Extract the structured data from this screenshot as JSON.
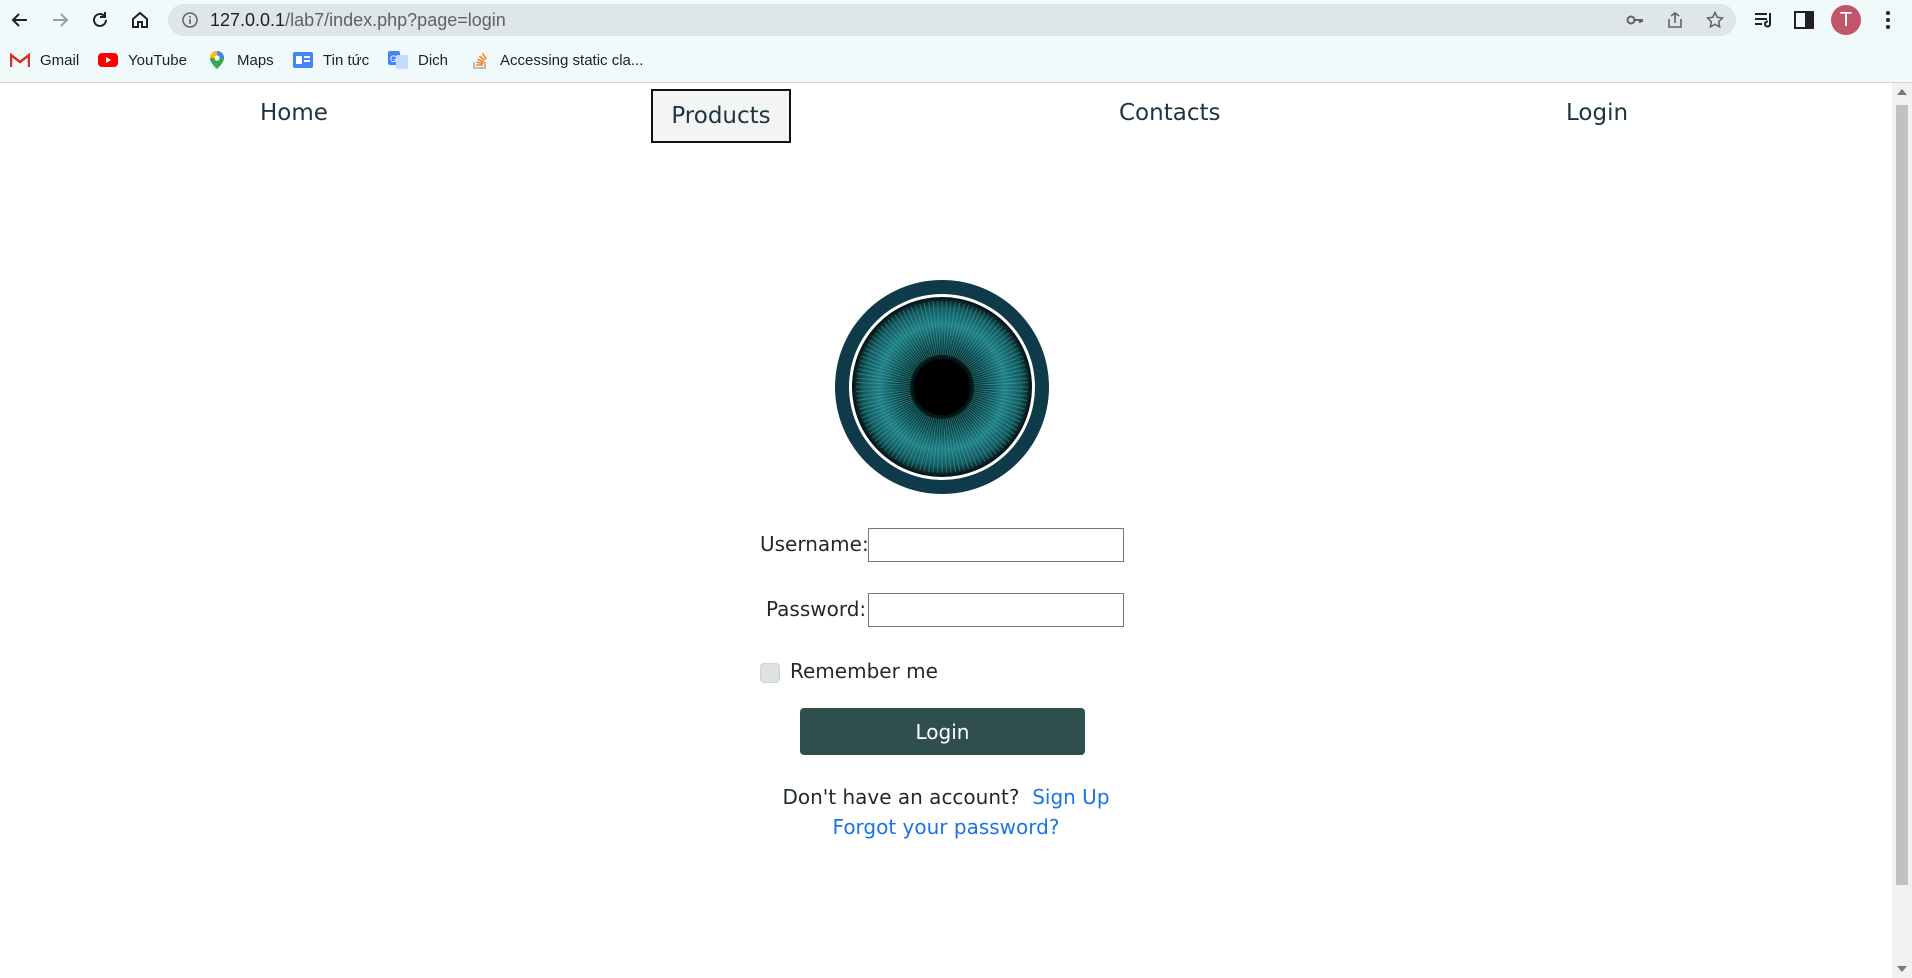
{
  "browser": {
    "url_host": "127.0.0.1",
    "url_path": "/lab7/index.php?page=login",
    "profile_initial": "T",
    "bookmarks": [
      {
        "label": "Gmail",
        "icon": "gmail-icon"
      },
      {
        "label": "YouTube",
        "icon": "youtube-icon"
      },
      {
        "label": "Maps",
        "icon": "maps-icon"
      },
      {
        "label": "Tin tức",
        "icon": "news-icon"
      },
      {
        "label": "Dich",
        "icon": "translate-icon"
      },
      {
        "label": "Accessing static cla...",
        "icon": "stackoverflow-icon"
      }
    ]
  },
  "nav": {
    "home": "Home",
    "products": "Products",
    "contacts": "Contacts",
    "login": "Login"
  },
  "form": {
    "username_label": "Username:",
    "password_label": "Password:",
    "username_value": "",
    "password_value": "",
    "remember_label": "Remember me",
    "remember_checked": false,
    "login_button": "Login",
    "no_account_text": "Don't have an account?",
    "signup_link": "Sign Up",
    "forgot_link": "Forgot your password?"
  },
  "colors": {
    "button_bg": "#2f4f4f",
    "logo_ring": "#0e3a4a",
    "logo_pattern": "#2fa3a8",
    "link": "#1a73e8"
  }
}
